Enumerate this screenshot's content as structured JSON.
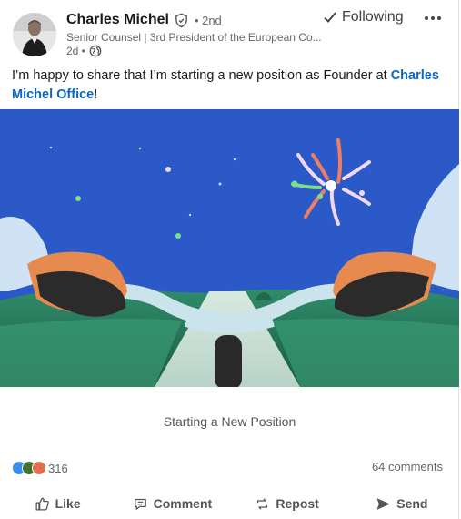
{
  "post": {
    "author": {
      "name": "Charles Michel",
      "degree": "• 2nd",
      "headline": "Senior Counsel | 3rd President of the European Co...",
      "time": "2d •"
    },
    "follow_label": "Following",
    "text_prefix": "I’m happy to share that I’m starting a new position as Founder at ",
    "text_link": "Charles Michel Office",
    "text_suffix": "!",
    "image_caption": "Starting a New Position"
  },
  "social": {
    "reactions_count": "316",
    "comments_label": "64 comments"
  },
  "actions": [
    {
      "label": "Like",
      "icon": "thumbs-up-icon"
    },
    {
      "label": "Comment",
      "icon": "comment-icon"
    },
    {
      "label": "Repost",
      "icon": "repost-icon"
    },
    {
      "label": "Send",
      "icon": "send-icon"
    }
  ],
  "colors": {
    "link": "#0a66c2",
    "sky": "#2b59c8",
    "like_blue": "#378fe9",
    "celebrate_green": "#44712e",
    "love_red": "#df704d"
  }
}
